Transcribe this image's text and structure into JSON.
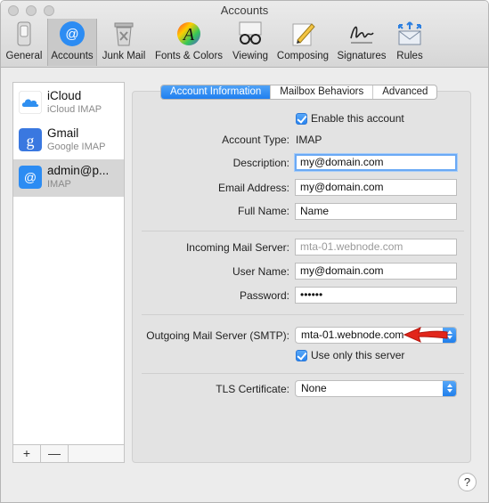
{
  "window": {
    "title": "Accounts"
  },
  "toolbar": {
    "items": [
      {
        "label": "General"
      },
      {
        "label": "Accounts"
      },
      {
        "label": "Junk Mail"
      },
      {
        "label": "Fonts & Colors"
      },
      {
        "label": "Viewing"
      },
      {
        "label": "Composing"
      },
      {
        "label": "Signatures"
      },
      {
        "label": "Rules"
      }
    ]
  },
  "sidebar": {
    "accounts": [
      {
        "name": "iCloud",
        "type": "iCloud IMAP",
        "icon": "cloud-icon"
      },
      {
        "name": "Gmail",
        "type": "Google IMAP",
        "icon": "google-icon"
      },
      {
        "name": "admin@p...",
        "type": "IMAP",
        "icon": "at-icon"
      }
    ],
    "add_label": "+",
    "remove_label": "—"
  },
  "tabs": [
    {
      "label": "Account Information"
    },
    {
      "label": "Mailbox Behaviors"
    },
    {
      "label": "Advanced"
    }
  ],
  "form": {
    "enable_label": "Enable this account",
    "account_type_label": "Account Type:",
    "account_type_value": "IMAP",
    "description_label": "Description:",
    "description_value": "my@domain.com",
    "email_label": "Email Address:",
    "email_value": "my@domain.com",
    "fullname_label": "Full Name:",
    "fullname_value": "Name",
    "incoming_label": "Incoming Mail Server:",
    "incoming_value": "mta-01.webnode.com",
    "username_label": "User Name:",
    "username_value": "my@domain.com",
    "password_label": "Password:",
    "password_value": "••••••",
    "smtp_label": "Outgoing Mail Server (SMTP):",
    "smtp_value": "mta-01.webnode.com",
    "use_only_label": "Use only this server",
    "tls_label": "TLS Certificate:",
    "tls_value": "None"
  },
  "help": {
    "label": "?"
  },
  "colors": {
    "accent": "#1f7ff0",
    "annotation_arrow": "#e2261b"
  }
}
